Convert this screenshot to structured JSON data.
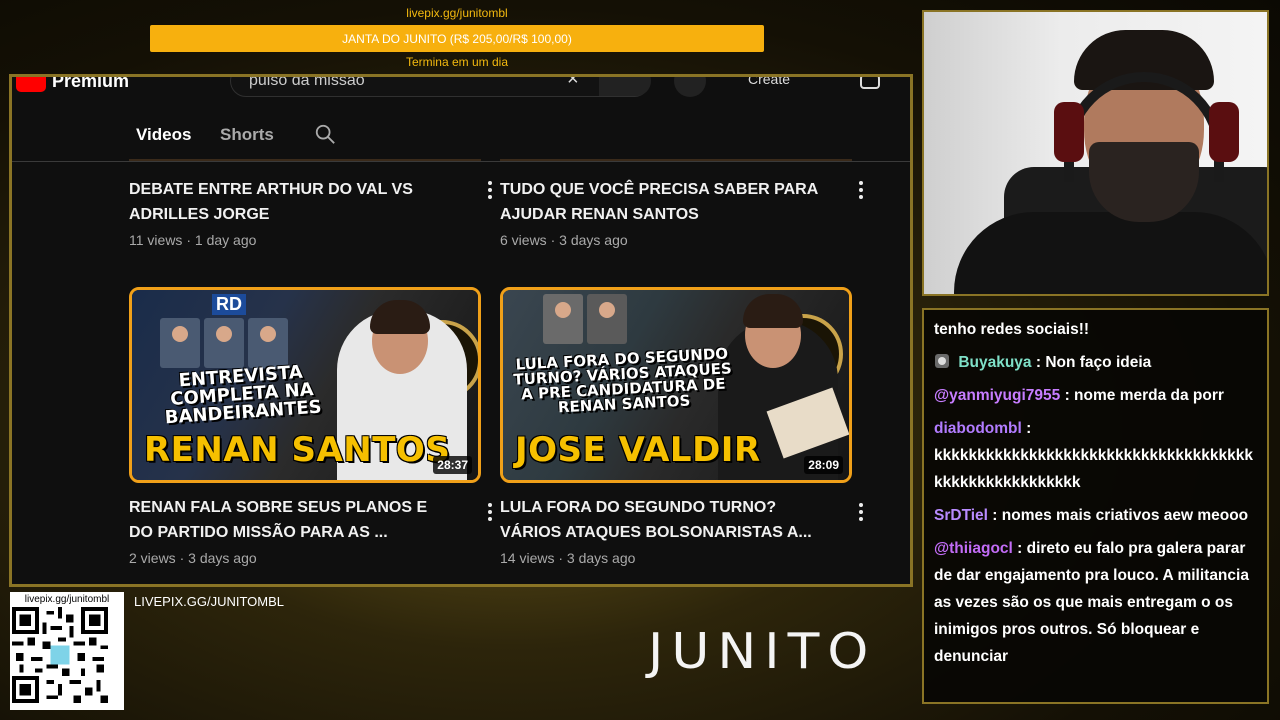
{
  "donation": {
    "url": "livepix.gg/junitombl",
    "goal_text": "JANTA DO JUNITO (R$ 205,00/R$ 100,00)",
    "ends_text": "Termina em um dia"
  },
  "youtube": {
    "logo_text": "Premium",
    "search_value": "pulso da missão",
    "create_label": "Create",
    "tabs": [
      {
        "label": "Videos",
        "active": true
      },
      {
        "label": "Shorts",
        "active": false
      }
    ],
    "videos": [
      {
        "title": "DEBATE ENTRE ARTHUR DO VAL VS ADRILLES JORGE",
        "views": "11 views",
        "age": "1 day ago"
      },
      {
        "title": "TUDO QUE VOCÊ PRECISA SABER PARA AJUDAR RENAN SANTOS",
        "views": "6 views",
        "age": "3 days ago"
      },
      {
        "title": "RENAN FALA SOBRE SEUS PLANOS E DO PARTIDO MISSÃO PARA AS ...",
        "views": "2 views",
        "age": "3 days ago",
        "duration": "28:37",
        "thumb_caption": "ENTREVISTA COMPLETA NA BANDEIRANTES",
        "thumb_title": "RENAN SANTOS",
        "thumb_logo": "RD"
      },
      {
        "title": "LULA FORA DO SEGUNDO TURNO? VÁRIOS ATAQUES BOLSONARISTAS A...",
        "views": "14 views",
        "age": "3 days ago",
        "duration": "28:09",
        "thumb_caption": "LULA FORA DO SEGUNDO TURNO? VÁRIOS ATAQUES A PRE CANDIDATURA DE RENAN SANTOS",
        "thumb_title": "JOSE VALDIR"
      }
    ]
  },
  "chat": {
    "messages": [
      {
        "user": "",
        "text": "tenho redes sociais!!",
        "color": "#ffffff"
      },
      {
        "user": "Buyakuya",
        "text": "Non faço ideia",
        "color": "#7fe0c8",
        "badge": true
      },
      {
        "user": "@yanmiyugi7955",
        "text": "nome merda da porr",
        "color": "#c77dff"
      },
      {
        "user": "diabodombl",
        "text": "kkkkkkkkkkkkkkkkkkkkkkkkkkkkkkkkkkkkkkkkkkkkkkkkkkkkkk",
        "color": "#b27cff"
      },
      {
        "user": "SrDTiel",
        "text": "nomes mais criativos aew meooo",
        "color": "#b88bff"
      },
      {
        "user": "@thiiagocl",
        "text": "direto eu falo pra galera parar de dar engajamento pra louco. A militancia as vezes são os que mais entregam o os inimigos pros outros. Só bloquear e denunciar",
        "color": "#c26cf6"
      }
    ]
  },
  "footer": {
    "qr_url": "livepix.gg/junitombl",
    "livepix_label": "LIVEPIX.GG/JUNITOMBL",
    "brand": "JUNITO"
  }
}
